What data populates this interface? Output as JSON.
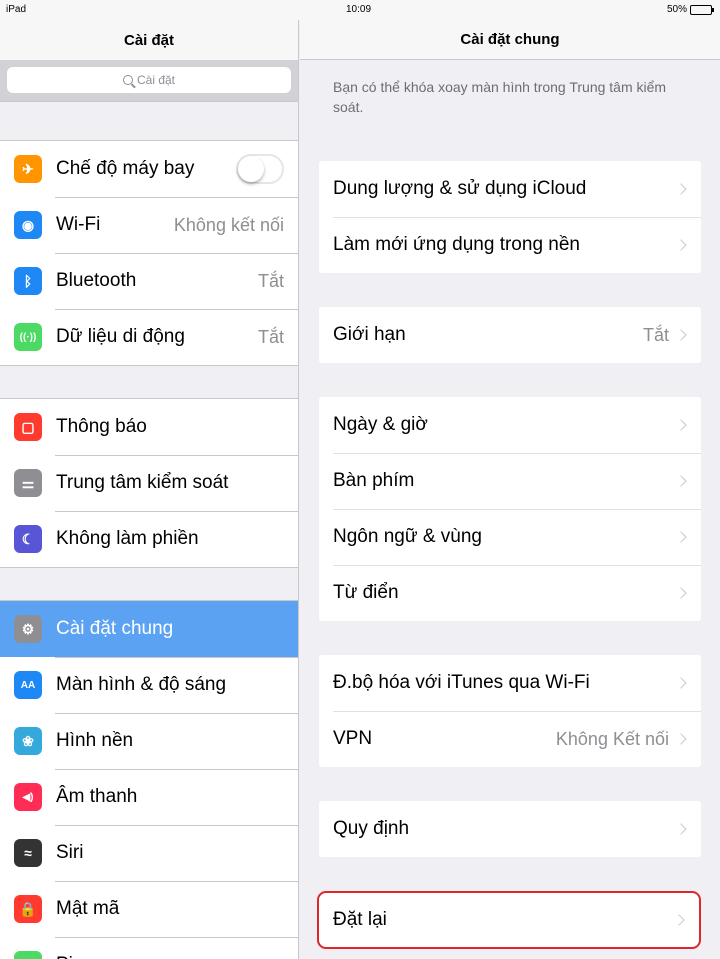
{
  "status_bar": {
    "device": "iPad",
    "time": "10:09",
    "battery": "50%",
    "battery_level": 0.5
  },
  "master": {
    "title": "Cài đặt",
    "search_placeholder": "Cài đặt",
    "groups": [
      [
        {
          "label": "Chế độ máy bay",
          "icon": "airplane-icon",
          "color": "#ff9500",
          "toggle": false
        },
        {
          "label": "Wi-Fi",
          "icon": "wifi-icon",
          "color": "#1e88f5",
          "value": "Không kết nối"
        },
        {
          "label": "Bluetooth",
          "icon": "bluetooth-icon",
          "color": "#1e88f5",
          "value": "Tắt"
        },
        {
          "label": "Dữ liệu di động",
          "icon": "cellular-icon",
          "color": "#4cd964",
          "value": "Tắt"
        }
      ],
      [
        {
          "label": "Thông báo",
          "icon": "notifications-icon",
          "color": "#ff3b30"
        },
        {
          "label": "Trung tâm kiểm soát",
          "icon": "control-center-icon",
          "color": "#8e8e93"
        },
        {
          "label": "Không làm phiền",
          "icon": "moon-icon",
          "color": "#5856d6"
        }
      ],
      [
        {
          "label": "Cài đặt chung",
          "icon": "gear-icon",
          "color": "#8e8e93",
          "selected": true
        },
        {
          "label": "Màn hình & độ sáng",
          "icon": "display-icon",
          "color": "#1e88f5"
        },
        {
          "label": "Hình nền",
          "icon": "wallpaper-icon",
          "color": "#34aadc"
        },
        {
          "label": "Âm thanh",
          "icon": "sound-icon",
          "color": "#ff2d55"
        },
        {
          "label": "Siri",
          "icon": "siri-icon",
          "color": "#333333"
        },
        {
          "label": "Mật mã",
          "icon": "lock-icon",
          "color": "#ff3b30"
        },
        {
          "label": "Pin",
          "icon": "battery-icon",
          "color": "#4cd964"
        }
      ]
    ]
  },
  "detail": {
    "title": "Cài đặt chung",
    "note": "Bạn có thể khóa xoay màn hình trong Trung tâm kiểm soát.",
    "groups": [
      [
        {
          "label": "Dung lượng & sử dụng iCloud"
        },
        {
          "label": "Làm mới ứng dụng trong nền"
        }
      ],
      [
        {
          "label": "Giới hạn",
          "value": "Tắt"
        }
      ],
      [
        {
          "label": "Ngày & giờ"
        },
        {
          "label": "Bàn phím"
        },
        {
          "label": "Ngôn ngữ & vùng"
        },
        {
          "label": "Từ điển"
        }
      ],
      [
        {
          "label": "Đ.bộ hóa với iTunes qua Wi-Fi"
        },
        {
          "label": "VPN",
          "value": "Không Kết nối"
        }
      ],
      [
        {
          "label": "Quy định"
        }
      ],
      [
        {
          "label": "Đặt lại",
          "highlight": true
        }
      ]
    ]
  },
  "colors": {
    "selected_row": "#5ba3f2",
    "highlight_border": "#e0262b"
  }
}
